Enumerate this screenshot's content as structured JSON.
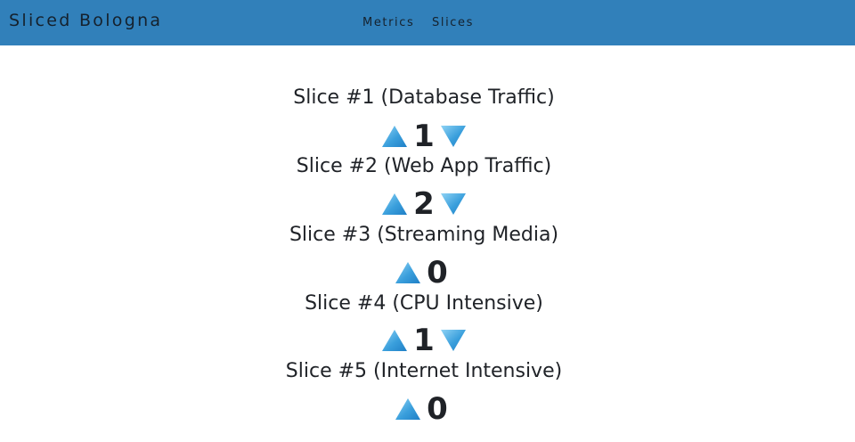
{
  "navbar": {
    "brand": "Sliced Bologna",
    "links": [
      "Metrics",
      "Slices"
    ]
  },
  "slices": [
    {
      "title": "Slice #1 (Database Traffic)",
      "count": "1",
      "has_down": true
    },
    {
      "title": "Slice #2 (Web App Traffic)",
      "count": "2",
      "has_down": true
    },
    {
      "title": "Slice #3 (Streaming Media)",
      "count": "0",
      "has_down": false
    },
    {
      "title": "Slice #4 (CPU Intensive)",
      "count": "1",
      "has_down": true
    },
    {
      "title": "Slice #5 (Internet Intensive)",
      "count": "0",
      "has_down": false
    }
  ],
  "icons": {
    "increment": "triangle-up-icon",
    "decrement": "triangle-down-icon"
  },
  "colors": {
    "navbar_bg": "#3180ba",
    "triangle_light": "#7ec8ef",
    "triangle_dark": "#1c7bc4"
  }
}
